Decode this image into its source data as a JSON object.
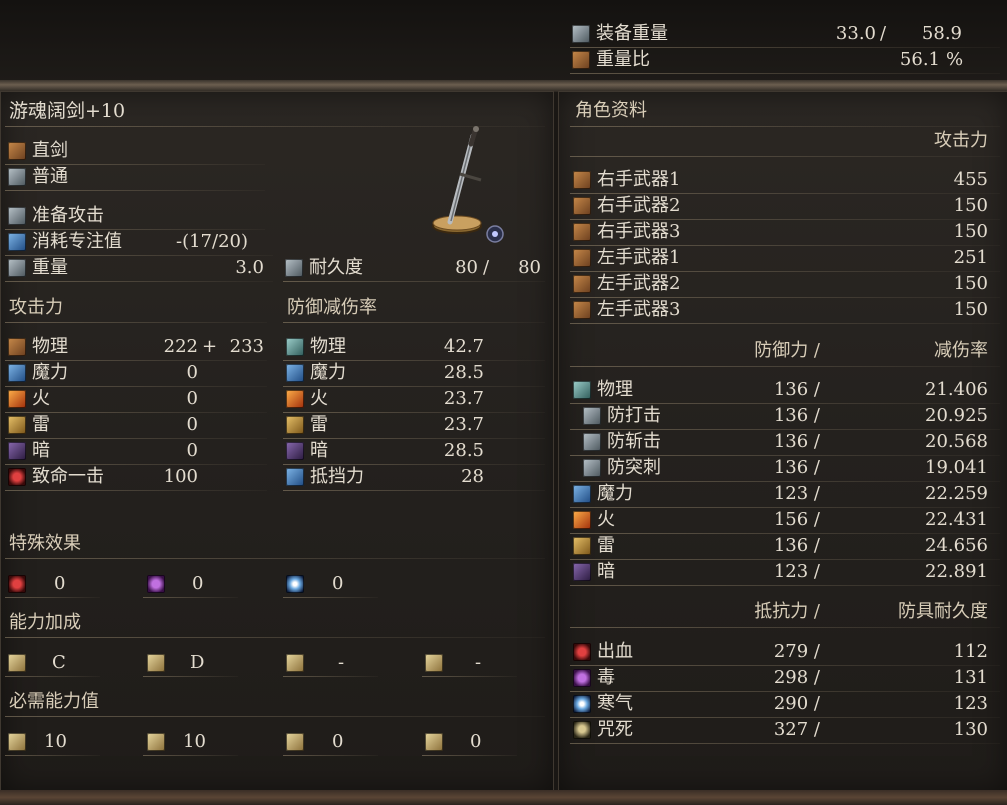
{
  "top": {
    "equip_weight": {
      "label": "装备重量",
      "current": "33.0",
      "sep": "/",
      "max": "58.9"
    },
    "weight_ratio": {
      "label": "重量比",
      "value": "56.1",
      "unit": "%"
    }
  },
  "weapon": {
    "name": "游魂阔剑+10",
    "type": "直剑",
    "attack_type": "普通",
    "skill": "准备攻击",
    "fp_cost": {
      "label": "消耗专注值",
      "value": "-(17/20)"
    },
    "weight": {
      "label": "重量",
      "value": "3.0"
    },
    "durability": {
      "label": "耐久度",
      "current": "80",
      "sep": "/",
      "max": "80"
    }
  },
  "attack": {
    "header": "攻击力",
    "rows": [
      {
        "label": "物理",
        "value": "222",
        "extra": "+",
        "extra2": "233"
      },
      {
        "label": "魔力",
        "value": "0"
      },
      {
        "label": "火",
        "value": "0"
      },
      {
        "label": "雷",
        "value": "0"
      },
      {
        "label": "暗",
        "value": "0"
      },
      {
        "label": "致命一击",
        "value": "100"
      }
    ]
  },
  "guard": {
    "header": "防御减伤率",
    "rows": [
      {
        "label": "物理",
        "value": "42.7"
      },
      {
        "label": "魔力",
        "value": "28.5"
      },
      {
        "label": "火",
        "value": "23.7"
      },
      {
        "label": "雷",
        "value": "23.7"
      },
      {
        "label": "暗",
        "value": "28.5"
      },
      {
        "label": "抵挡力",
        "value": "28"
      }
    ]
  },
  "special": {
    "header": "特殊效果",
    "values": [
      "0",
      "0",
      "0"
    ]
  },
  "scaling": {
    "header": "能力加成",
    "values": [
      "C",
      "D",
      "-",
      "-"
    ]
  },
  "requirements": {
    "header": "必需能力值",
    "values": [
      "10",
      "10",
      "0",
      "0"
    ]
  },
  "char": {
    "header": "角色资料",
    "attack_header": "攻击力",
    "weapons": [
      {
        "label": "右手武器1",
        "value": "455"
      },
      {
        "label": "右手武器2",
        "value": "150"
      },
      {
        "label": "右手武器3",
        "value": "150"
      },
      {
        "label": "左手武器1",
        "value": "251"
      },
      {
        "label": "左手武器2",
        "value": "150"
      },
      {
        "label": "左手武器3",
        "value": "150"
      }
    ],
    "defense_header": "防御力 /",
    "absorb_header": "减伤率",
    "defense": [
      {
        "label": "物理",
        "def": "136 /",
        "abs": "21.406"
      },
      {
        "label": "防打击",
        "def": "136 /",
        "abs": "20.925"
      },
      {
        "label": "防斩击",
        "def": "136 /",
        "abs": "20.568"
      },
      {
        "label": "防突刺",
        "def": "136 /",
        "abs": "19.041"
      },
      {
        "label": "魔力",
        "def": "123 /",
        "abs": "22.259"
      },
      {
        "label": "火",
        "def": "156 /",
        "abs": "22.431"
      },
      {
        "label": "雷",
        "def": "136 /",
        "abs": "24.656"
      },
      {
        "label": "暗",
        "def": "123 /",
        "abs": "22.891"
      }
    ],
    "resist_header": "抵抗力 /",
    "armor_dur_header": "防具耐久度",
    "resist": [
      {
        "label": "出血",
        "res": "279 /",
        "dur": "112"
      },
      {
        "label": "毒",
        "res": "298 /",
        "dur": "131"
      },
      {
        "label": "寒气",
        "res": "290 /",
        "dur": "123"
      },
      {
        "label": "咒死",
        "res": "327 /",
        "dur": "130"
      }
    ]
  }
}
